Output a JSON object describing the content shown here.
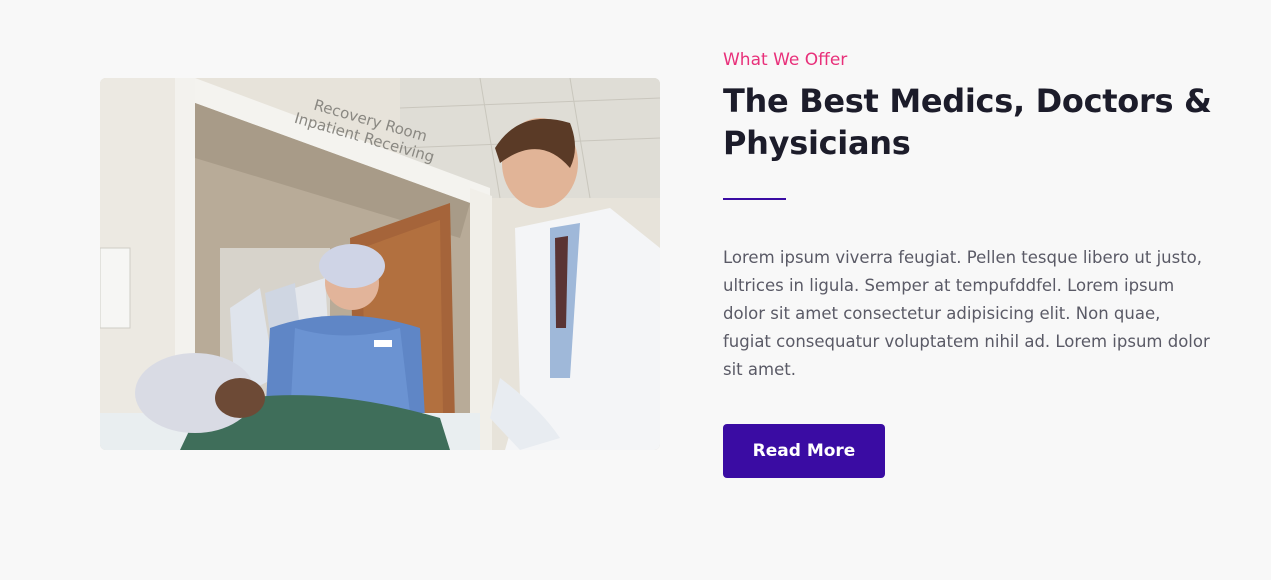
{
  "section": {
    "subtitle": "What We Offer",
    "title": "The Best Medics, Doctors & Physicians",
    "body": "Lorem ipsum viverra feugiat. Pellen tesque libero ut justo, ultrices in ligula. Semper at tempufddfel. Lorem ipsum dolor sit amet consectetur adipisicing elit. Non quae, fugiat consequatur voluptatem nihil ad. Lorem ipsum dolor sit amet.",
    "button_label": "Read More"
  },
  "photo": {
    "sign_line1": "Recovery Room",
    "sign_line2": "Inpatient Receiving"
  },
  "colors": {
    "accent_pink": "#e8307a",
    "primary_purple": "#3a0ca3",
    "title_color": "#1c1c2a",
    "body_color": "#5a5a66",
    "background": "#f8f8f8"
  }
}
